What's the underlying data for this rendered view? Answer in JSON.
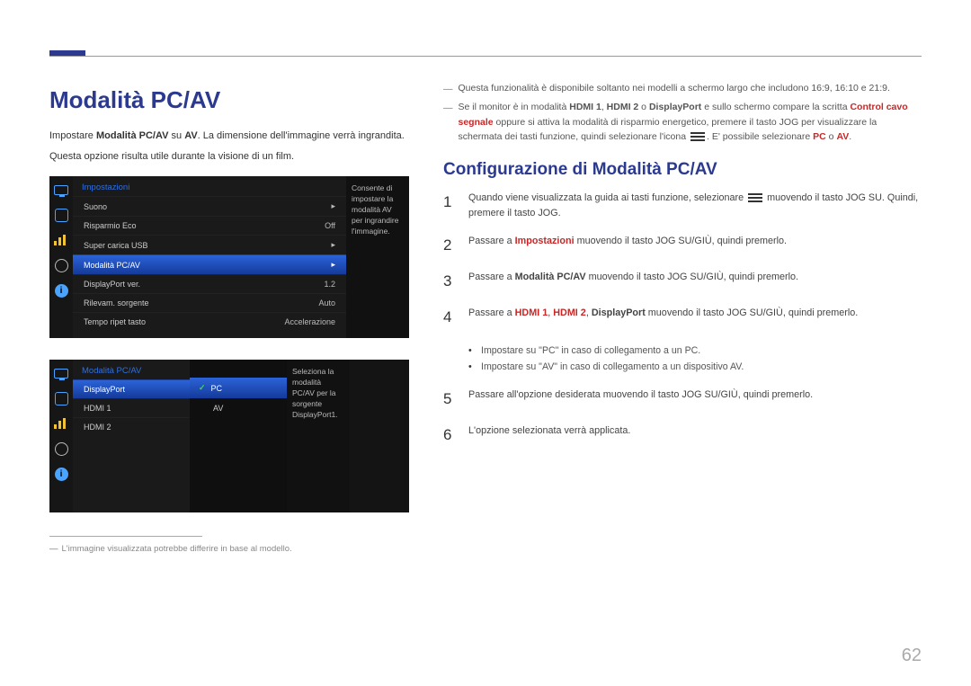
{
  "page_number": "62",
  "title": "Modalità PC/AV",
  "intro_html": "Impostare <span class='bold'>Modalità PC/AV</span> su <span class='bold'>AV</span>. La dimensione dell'immagine verrà ingrandita.",
  "intro2": "Questa opzione risulta utile durante la visione di un film.",
  "osd1": {
    "header": "Impostazioni",
    "rows": [
      {
        "label": "Suono",
        "val": "▸"
      },
      {
        "label": "Risparmio Eco",
        "val": "Off"
      },
      {
        "label": "Super carica USB",
        "val": "▸"
      },
      {
        "label": "Modalità PC/AV",
        "val": "▸",
        "selected": true
      },
      {
        "label": "DisplayPort ver.",
        "val": "1.2"
      },
      {
        "label": "Rilevam. sorgente",
        "val": "Auto"
      },
      {
        "label": "Tempo ripet tasto",
        "val": "Accelerazione"
      }
    ],
    "desc": "Consente di impostare la modalità AV per ingrandire l'immagine."
  },
  "osd2": {
    "header": "Modalità PC/AV",
    "rows": [
      {
        "label": "DisplayPort",
        "selected": true
      },
      {
        "label": "HDMI 1"
      },
      {
        "label": "HDMI 2"
      }
    ],
    "subrows": [
      {
        "label": "PC",
        "selected": true,
        "check": true
      },
      {
        "label": "AV"
      }
    ],
    "desc": "Seleziona la modalità PC/AV per la sorgente DisplayPort1."
  },
  "footnote": "L'immagine visualizzata potrebbe differire in base al modello.",
  "notes": {
    "n1": "Questa funzionalità è disponibile soltanto nei modelli a schermo largo che includono 16:9, 16:10 e 21:9.",
    "n2_pre": "Se il monitor è in modalità ",
    "n2_hdmi1": "HDMI 1",
    "n2_hdmi2": "HDMI 2",
    "n2_dp": "DisplayPort",
    "n2_mid1": " e sullo schermo compare la scritta ",
    "n2_ctrl": "Control cavo segnale",
    "n2_cont": " oppure si attiva la modalità di risparmio energetico, premere il tasto JOG per visualizzare la schermata dei tasti funzione, quindi selezionare l'icona ",
    "n2_tail": ". E' possibile selezionare ",
    "n2_pc": "PC",
    "n2_or": " o ",
    "n2_av": "AV",
    "n2_dot": "."
  },
  "section2_title": "Configurazione di Modalità PC/AV",
  "steps": {
    "s1a": "Quando viene visualizzata la guida ai tasti funzione, selezionare ",
    "s1b": " muovendo il tasto JOG SU. Quindi, premere il tasto JOG.",
    "s2a": "Passare a ",
    "s2b": "Impostazioni",
    "s2c": " muovendo il tasto JOG SU/GIÙ, quindi premerlo.",
    "s3a": "Passare a ",
    "s3b": "Modalità PC/AV",
    "s3c": " muovendo il tasto JOG SU/GIÙ, quindi premerlo.",
    "s4a": "Passare a ",
    "s4b": "HDMI 1",
    "s4c": "HDMI 2",
    "s4d": "DisplayPort",
    "s4e": " muovendo il tasto JOG SU/GIÙ, quindi premerlo.",
    "b1": "Impostare su \"PC\" in caso di collegamento a un PC.",
    "b2": "Impostare su \"AV\" in caso di collegamento a un dispositivo AV.",
    "s5": "Passare all'opzione desiderata muovendo il tasto JOG SU/GIÙ, quindi premerlo.",
    "s6": "L'opzione selezionata verrà applicata."
  }
}
